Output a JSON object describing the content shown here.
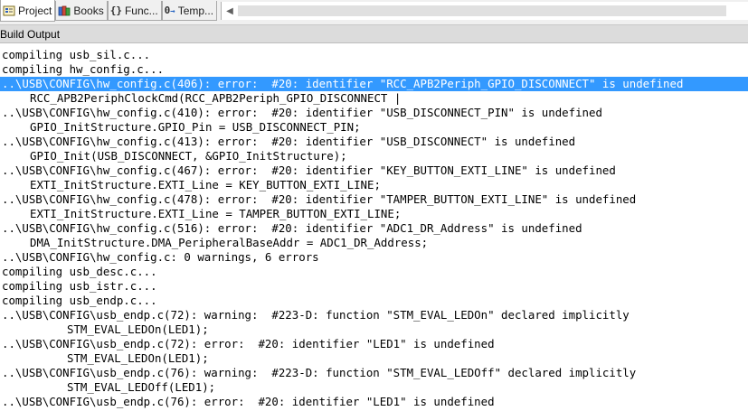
{
  "tabs": [
    {
      "label": "Project",
      "icon": "project-icon",
      "active": true
    },
    {
      "label": "Books",
      "icon": "books-icon",
      "active": false
    },
    {
      "label": "Func...",
      "icon": "functions-icon",
      "active": false
    },
    {
      "label": "Temp...",
      "icon": "templates-icon",
      "active": false
    }
  ],
  "panel": {
    "title": "Build Output"
  },
  "output_lines": [
    {
      "text": "compiling usb_sil.c...",
      "indent": 0,
      "selected": false
    },
    {
      "text": "compiling hw_config.c...",
      "indent": 0,
      "selected": false
    },
    {
      "text": "..\\USB\\CONFIG\\hw_config.c(406): error:  #20: identifier \"RCC_APB2Periph_GPIO_DISCONNECT\" is undefined",
      "indent": 0,
      "selected": true
    },
    {
      "text": "RCC_APB2PeriphClockCmd(RCC_APB2Periph_GPIO_DISCONNECT |",
      "indent": 1,
      "selected": false
    },
    {
      "text": "..\\USB\\CONFIG\\hw_config.c(410): error:  #20: identifier \"USB_DISCONNECT_PIN\" is undefined",
      "indent": 0,
      "selected": false
    },
    {
      "text": "GPIO_InitStructure.GPIO_Pin = USB_DISCONNECT_PIN;",
      "indent": 1,
      "selected": false
    },
    {
      "text": "..\\USB\\CONFIG\\hw_config.c(413): error:  #20: identifier \"USB_DISCONNECT\" is undefined",
      "indent": 0,
      "selected": false
    },
    {
      "text": "GPIO_Init(USB_DISCONNECT, &GPIO_InitStructure);",
      "indent": 1,
      "selected": false
    },
    {
      "text": "..\\USB\\CONFIG\\hw_config.c(467): error:  #20: identifier \"KEY_BUTTON_EXTI_LINE\" is undefined",
      "indent": 0,
      "selected": false
    },
    {
      "text": "EXTI_InitStructure.EXTI_Line = KEY_BUTTON_EXTI_LINE;",
      "indent": 1,
      "selected": false
    },
    {
      "text": "..\\USB\\CONFIG\\hw_config.c(478): error:  #20: identifier \"TAMPER_BUTTON_EXTI_LINE\" is undefined",
      "indent": 0,
      "selected": false
    },
    {
      "text": "EXTI_InitStructure.EXTI_Line = TAMPER_BUTTON_EXTI_LINE;",
      "indent": 1,
      "selected": false
    },
    {
      "text": "..\\USB\\CONFIG\\hw_config.c(516): error:  #20: identifier \"ADC1_DR_Address\" is undefined",
      "indent": 0,
      "selected": false
    },
    {
      "text": "DMA_InitStructure.DMA_PeripheralBaseAddr = ADC1_DR_Address;",
      "indent": 1,
      "selected": false
    },
    {
      "text": "..\\USB\\CONFIG\\hw_config.c: 0 warnings, 6 errors",
      "indent": 0,
      "selected": false
    },
    {
      "text": "compiling usb_desc.c...",
      "indent": 0,
      "selected": false
    },
    {
      "text": "compiling usb_istr.c...",
      "indent": 0,
      "selected": false
    },
    {
      "text": "compiling usb_endp.c...",
      "indent": 0,
      "selected": false
    },
    {
      "text": "..\\USB\\CONFIG\\usb_endp.c(72): warning:  #223-D: function \"STM_EVAL_LEDOn\" declared implicitly",
      "indent": 0,
      "selected": false
    },
    {
      "text": "STM_EVAL_LEDOn(LED1);",
      "indent": 2,
      "selected": false
    },
    {
      "text": "..\\USB\\CONFIG\\usb_endp.c(72): error:  #20: identifier \"LED1\" is undefined",
      "indent": 0,
      "selected": false
    },
    {
      "text": "STM_EVAL_LEDOn(LED1);",
      "indent": 2,
      "selected": false
    },
    {
      "text": "..\\USB\\CONFIG\\usb_endp.c(76): warning:  #223-D: function \"STM_EVAL_LEDOff\" declared implicitly",
      "indent": 0,
      "selected": false
    },
    {
      "text": "STM_EVAL_LEDOff(LED1);",
      "indent": 2,
      "selected": false
    },
    {
      "text": "..\\USB\\CONFIG\\usb_endp.c(76): error:  #20: identifier \"LED1\" is undefined",
      "indent": 0,
      "selected": false
    }
  ],
  "colors": {
    "selection": "#3399ff",
    "panel_title_bg": "#dcdcdc"
  }
}
